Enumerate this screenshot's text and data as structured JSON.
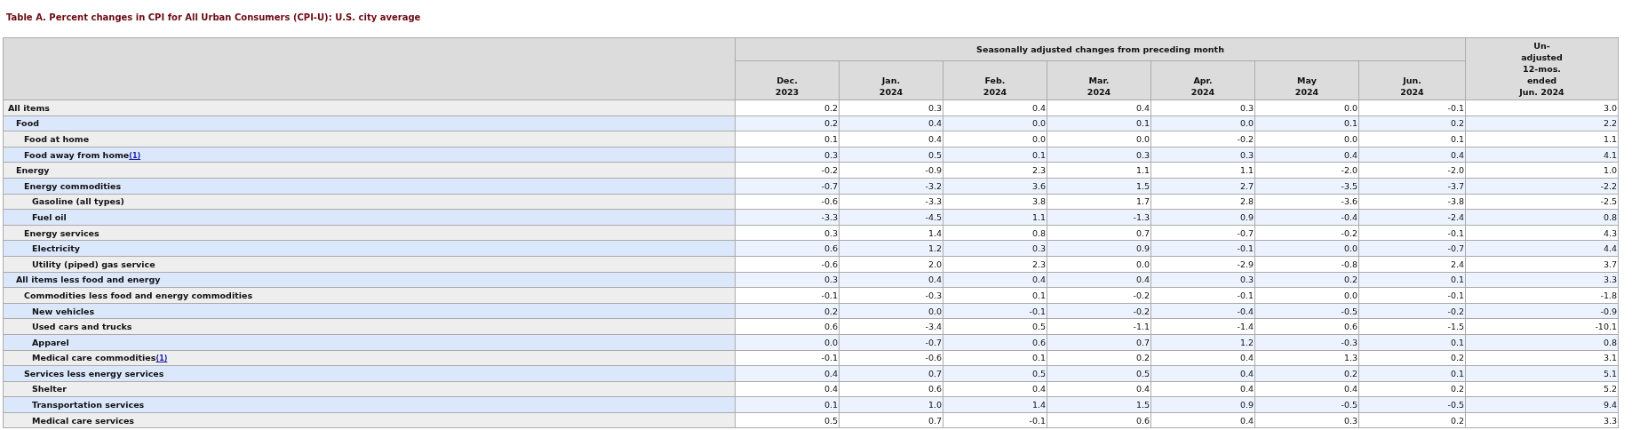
{
  "title": "Table A. Percent changes in CPI for All Urban Consumers (CPI-U): U.S. city average",
  "header": {
    "group": "Seasonally adjusted changes from preceding month",
    "months": [
      [
        "Dec.",
        "2023"
      ],
      [
        "Jan.",
        "2024"
      ],
      [
        "Feb.",
        "2024"
      ],
      [
        "Mar.",
        "2024"
      ],
      [
        "Apr.",
        "2024"
      ],
      [
        "May",
        "2024"
      ],
      [
        "Jun.",
        "2024"
      ]
    ],
    "annual": [
      "Un-",
      "adjusted",
      "12-mos.",
      "ended",
      "Jun. 2024"
    ]
  },
  "rows": [
    {
      "label": "All items",
      "values": [
        "0.2",
        "0.3",
        "0.4",
        "0.4",
        "0.3",
        "0.0",
        "-0.1",
        "3.0"
      ],
      "children": [
        {
          "label": "Food",
          "values": [
            "0.2",
            "0.4",
            "0.0",
            "0.1",
            "0.0",
            "0.1",
            "0.2",
            "2.2"
          ],
          "children": [
            {
              "label": "Food at home",
              "values": [
                "0.1",
                "0.4",
                "0.0",
                "0.0",
                "-0.2",
                "0.0",
                "0.1",
                "1.1"
              ]
            },
            {
              "label": "Food away from home",
              "footnote": "(1)",
              "values": [
                "0.3",
                "0.5",
                "0.1",
                "0.3",
                "0.3",
                "0.4",
                "0.4",
                "4.1"
              ]
            }
          ]
        },
        {
          "label": "Energy",
          "values": [
            "-0.2",
            "-0.9",
            "2.3",
            "1.1",
            "1.1",
            "-2.0",
            "-2.0",
            "1.0"
          ],
          "children": [
            {
              "label": "Energy commodities",
              "values": [
                "-0.7",
                "-3.2",
                "3.6",
                "1.5",
                "2.7",
                "-3.5",
                "-3.7",
                "-2.2"
              ],
              "children": [
                {
                  "label": "Gasoline (all types)",
                  "values": [
                    "-0.6",
                    "-3.3",
                    "3.8",
                    "1.7",
                    "2.8",
                    "-3.6",
                    "-3.8",
                    "-2.5"
                  ]
                },
                {
                  "label": "Fuel oil",
                  "values": [
                    "-3.3",
                    "-4.5",
                    "1.1",
                    "-1.3",
                    "0.9",
                    "-0.4",
                    "-2.4",
                    "0.8"
                  ]
                }
              ]
            },
            {
              "label": "Energy services",
              "values": [
                "0.3",
                "1.4",
                "0.8",
                "0.7",
                "-0.7",
                "-0.2",
                "-0.1",
                "4.3"
              ],
              "children": [
                {
                  "label": "Electricity",
                  "values": [
                    "0.6",
                    "1.2",
                    "0.3",
                    "0.9",
                    "-0.1",
                    "0.0",
                    "-0.7",
                    "4.4"
                  ]
                },
                {
                  "label": "Utility (piped) gas service",
                  "values": [
                    "-0.6",
                    "2.0",
                    "2.3",
                    "0.0",
                    "-2.9",
                    "-0.8",
                    "2.4",
                    "3.7"
                  ]
                }
              ]
            }
          ]
        },
        {
          "label": "All items less food and energy",
          "values": [
            "0.3",
            "0.4",
            "0.4",
            "0.4",
            "0.3",
            "0.2",
            "0.1",
            "3.3"
          ],
          "children": [
            {
              "label": "Commodities less food and energy commodities",
              "values": [
                "-0.1",
                "-0.3",
                "0.1",
                "-0.2",
                "-0.1",
                "0.0",
                "-0.1",
                "-1.8"
              ],
              "children": [
                {
                  "label": "New vehicles",
                  "values": [
                    "0.2",
                    "0.0",
                    "-0.1",
                    "-0.2",
                    "-0.4",
                    "-0.5",
                    "-0.2",
                    "-0.9"
                  ]
                },
                {
                  "label": "Used cars and trucks",
                  "values": [
                    "0.6",
                    "-3.4",
                    "0.5",
                    "-1.1",
                    "-1.4",
                    "0.6",
                    "-1.5",
                    "-10.1"
                  ]
                },
                {
                  "label": "Apparel",
                  "values": [
                    "0.0",
                    "-0.7",
                    "0.6",
                    "0.7",
                    "1.2",
                    "-0.3",
                    "0.1",
                    "0.8"
                  ]
                },
                {
                  "label": "Medical care commodities",
                  "footnote": "(1)",
                  "values": [
                    "-0.1",
                    "-0.6",
                    "0.1",
                    "0.2",
                    "0.4",
                    "1.3",
                    "0.2",
                    "3.1"
                  ]
                }
              ]
            },
            {
              "label": "Services less energy services",
              "values": [
                "0.4",
                "0.7",
                "0.5",
                "0.5",
                "0.4",
                "0.2",
                "0.1",
                "5.1"
              ],
              "children": [
                {
                  "label": "Shelter",
                  "values": [
                    "0.4",
                    "0.6",
                    "0.4",
                    "0.4",
                    "0.4",
                    "0.4",
                    "0.2",
                    "5.2"
                  ]
                },
                {
                  "label": "Transportation services",
                  "values": [
                    "0.1",
                    "1.0",
                    "1.4",
                    "1.5",
                    "0.9",
                    "-0.5",
                    "-0.5",
                    "9.4"
                  ]
                },
                {
                  "label": "Medical care services",
                  "values": [
                    "0.5",
                    "0.7",
                    "-0.1",
                    "0.6",
                    "0.4",
                    "0.3",
                    "0.2",
                    "3.3"
                  ]
                }
              ]
            }
          ]
        }
      ]
    }
  ]
}
